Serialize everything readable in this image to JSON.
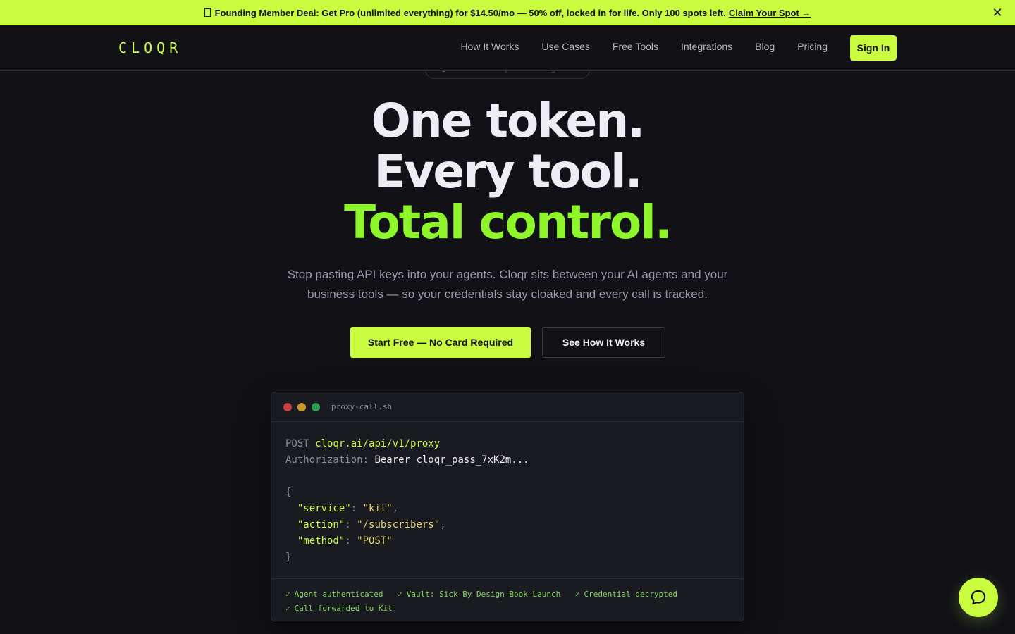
{
  "promo": {
    "icon": "ticket-icon",
    "text": "Founding Member Deal: Get Pro (unlimited everything) for $14.50/mo — 50% off, locked in for life. Only 100 spots left.",
    "link_label": "Claim Your Spot →",
    "close_label": "✕"
  },
  "nav": {
    "logo": "CLOQR",
    "links": [
      "How It Works",
      "Use Cases",
      "Free Tools",
      "Integrations",
      "Blog",
      "Pricing"
    ],
    "signin_label": "Sign In"
  },
  "hero": {
    "eyebrow": "API Security for AI Agents",
    "title_line1": "One token.",
    "title_line2": "Every tool.",
    "title_line3": "Total control.",
    "subtitle": "Stop pasting API keys into your agents. Cloqr sits between your AI agents and your business tools — so your credentials stay cloaked and every call is tracked.",
    "cta_primary": "Start Free — No Card Required",
    "cta_secondary": "See How It Works"
  },
  "terminal": {
    "filename": "proxy-call.sh",
    "method": "POST",
    "url": "cloqr.ai/api/v1/proxy",
    "auth_label": "Authorization:",
    "auth_value": "Bearer cloqr_pass_7xK2m...",
    "open_brace": "{",
    "close_brace": "}",
    "fields": [
      {
        "key": "\"service\"",
        "colon": ": ",
        "value": "\"kit\"",
        "comma": ","
      },
      {
        "key": "\"action\"",
        "colon": ": ",
        "value": "\"/subscribers\"",
        "comma": ","
      },
      {
        "key": "\"method\"",
        "colon": ": ",
        "value": "\"POST\"",
        "comma": ""
      }
    ],
    "checks": [
      "Agent authenticated",
      "Vault: Sick By Design Book Launch",
      "Credential decrypted",
      "Call forwarded to Kit"
    ],
    "check_glyph": "✓"
  },
  "chat": {
    "icon": "chat-bubble-icon"
  },
  "colors": {
    "accent": "#C9FB3F",
    "headline_accent": "#8EF52B",
    "background": "#111116",
    "dot_red": "#C8403F",
    "dot_yellow": "#C89A2A",
    "dot_green": "#2FA052"
  }
}
